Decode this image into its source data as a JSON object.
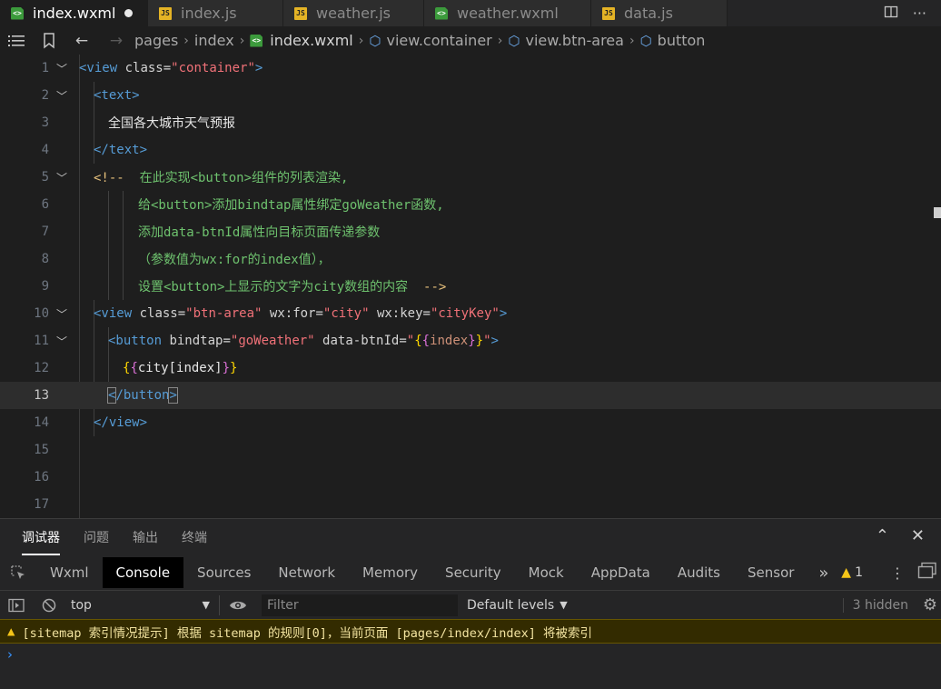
{
  "tabs": [
    {
      "label": "index.wxml",
      "type": "wxml",
      "active": true,
      "modified": true
    },
    {
      "label": "index.js",
      "type": "js",
      "active": false
    },
    {
      "label": "weather.js",
      "type": "js",
      "active": false
    },
    {
      "label": "weather.wxml",
      "type": "wxml",
      "active": false
    },
    {
      "label": "data.js",
      "type": "js",
      "active": false
    }
  ],
  "breadcrumb": {
    "pages": "pages",
    "index": "index",
    "file": "index.wxml",
    "container": "view.container",
    "btn_area": "view.btn-area",
    "button": "button"
  },
  "editor": {
    "line_numbers": [
      "1",
      "2",
      "3",
      "4",
      "5",
      "6",
      "7",
      "8",
      "9",
      "10",
      "11",
      "12",
      "13",
      "14",
      "15",
      "16",
      "17"
    ],
    "line3_text": "全国各大城市天气预报",
    "comment_open": "<!--",
    "comment_lines": [
      "在此实现<button>组件的列表渲染,",
      "给<button>添加bindtap属性绑定goWeather函数,",
      "添加data-btnId属性向目标页面传递参数",
      "（参数值为wx:for的index值），",
      "设置<button>上显示的文字为city数组的内容"
    ],
    "comment_close": "-->",
    "container_class": "\"container\"",
    "btn_area_class": "\"btn-area\"",
    "wx_for": "\"city\"",
    "wx_key": "\"cityKey\"",
    "bindtap": "\"goWeather\"",
    "index_expr": "index",
    "city_expr": "city[index]"
  },
  "panel": {
    "tabs": [
      "调试器",
      "问题",
      "输出",
      "终端"
    ],
    "devtools_tabs": [
      "Wxml",
      "Console",
      "Sources",
      "Network",
      "Memory",
      "Security",
      "Mock",
      "AppData",
      "Audits",
      "Sensor"
    ],
    "warning_count": "1",
    "context": "top",
    "filter_placeholder": "Filter",
    "levels": "Default levels",
    "hidden": "3 hidden",
    "message": "[sitemap 索引情况提示] 根据 sitemap 的规则[0]，当前页面 [pages/index/index] 将被索引"
  }
}
